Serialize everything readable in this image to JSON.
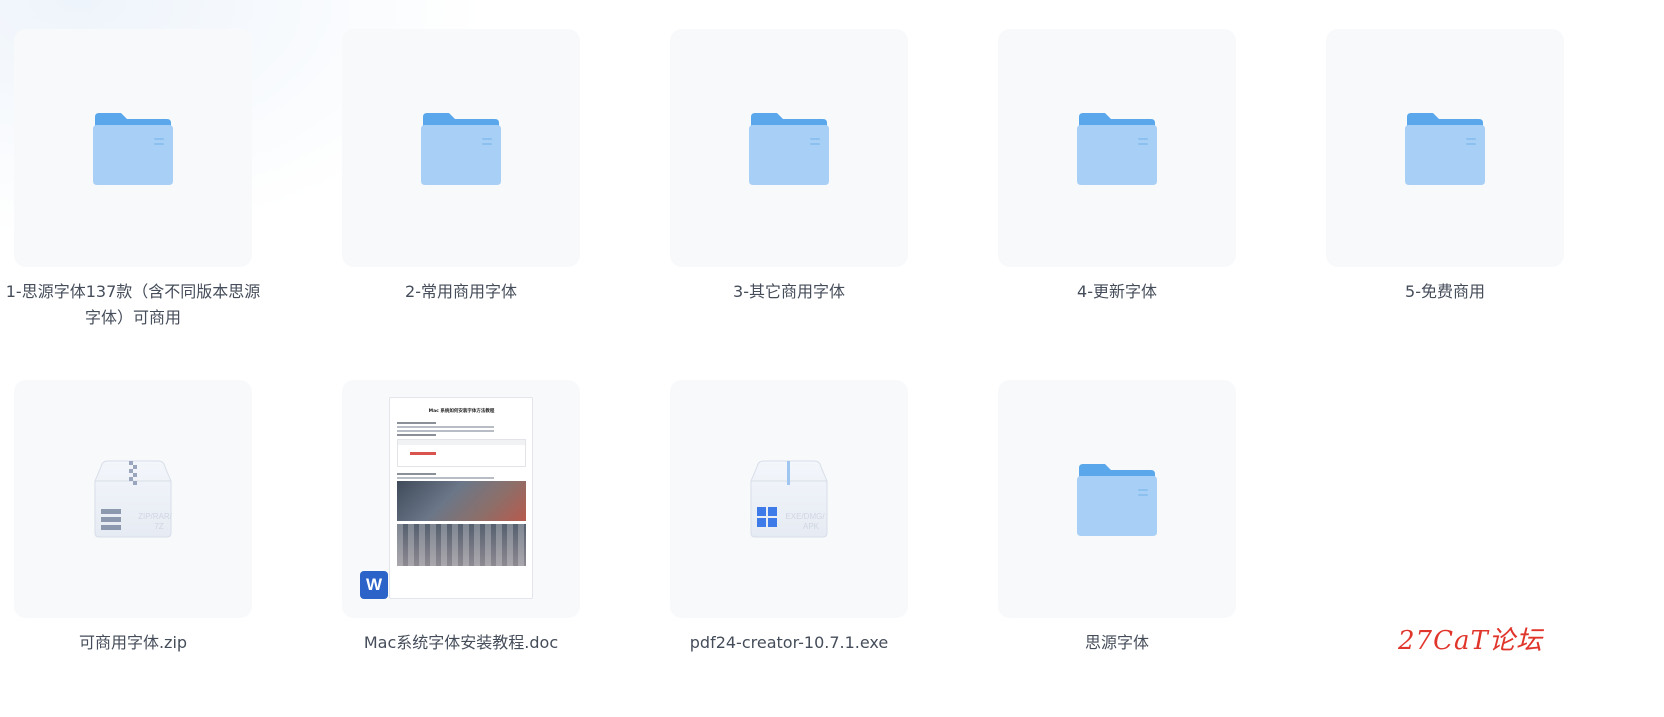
{
  "files": [
    {
      "name": "1-思源字体137款（含不同版本思源字体）可商用",
      "type": "folder",
      "icon": "folder-icon"
    },
    {
      "name": "2-常用商用字体",
      "type": "folder",
      "icon": "folder-icon"
    },
    {
      "name": "3-其它商用字体",
      "type": "folder",
      "icon": "folder-icon"
    },
    {
      "name": "4-更新字体",
      "type": "folder",
      "icon": "folder-icon"
    },
    {
      "name": "5-免费商用",
      "type": "folder",
      "icon": "folder-icon"
    },
    {
      "name": "可商用字体.zip",
      "type": "zip",
      "icon": "zip-archive-icon"
    },
    {
      "name": "Mac系统字体安装教程.doc",
      "type": "doc",
      "icon": "word-document-icon",
      "preview_title": "Mac 系统如何安装字体方法教程",
      "badge": "W"
    },
    {
      "name": "pdf24-creator-10.7.1.exe",
      "type": "exe",
      "icon": "windows-exe-icon"
    },
    {
      "name": "思源字体",
      "type": "folder",
      "icon": "folder-icon"
    }
  ],
  "watermark": "27CaT论坛",
  "colors": {
    "folder_light": "#a8d0f7",
    "folder_dark": "#5aa8eb",
    "text": "#454d5a",
    "tile_bg": "#f8f9fb",
    "word_blue": "#2b63c9",
    "watermark_red": "#e0352b"
  }
}
